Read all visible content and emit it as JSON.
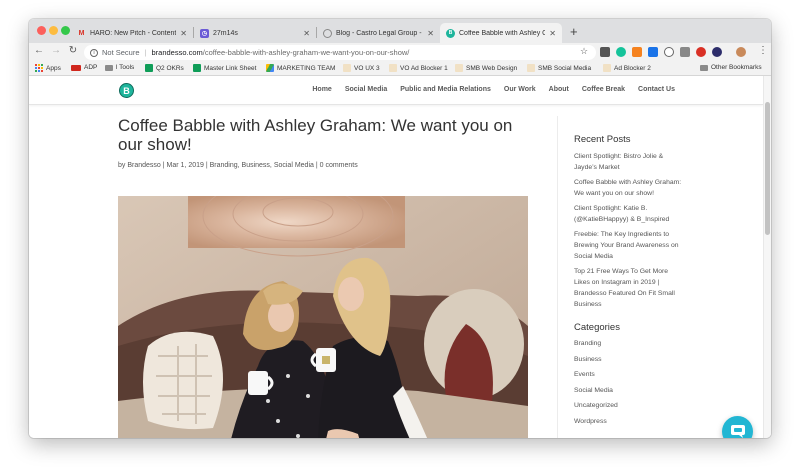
{
  "browser": {
    "tabs": [
      {
        "title": "HARO: New Pitch - Content M",
        "favicon": "gmail-icon",
        "active": false
      },
      {
        "title": "27m14s",
        "favicon": "timer-icon",
        "active": false
      },
      {
        "title": "Blog - Castro Legal Group - Ca",
        "favicon": "globe-icon",
        "active": false
      },
      {
        "title": "Coffee Babble with Ashley Gra",
        "favicon": "brandesso-icon",
        "active": true
      }
    ],
    "url": {
      "security_label": "Not Secure",
      "domain": "brandesso.com",
      "path": "/coffee-babble-with-ashley-graham-we-want-you-on-our-show/"
    },
    "bookmarks": [
      {
        "label": "Apps"
      },
      {
        "label": "ADP"
      },
      {
        "label": "l Tools"
      },
      {
        "label": "Q2 OKRs"
      },
      {
        "label": "Master Link Sheet"
      },
      {
        "label": "MARKETING TEAM"
      },
      {
        "label": "VO UX 3"
      },
      {
        "label": "VO Ad Blocker 1"
      },
      {
        "label": "SMB Web Design"
      },
      {
        "label": "SMB Social Media"
      },
      {
        "label": "Ad Blocker 2"
      },
      {
        "label": "Other Bookmarks"
      }
    ]
  },
  "site": {
    "logo_letter": "B",
    "nav": [
      "Home",
      "Social Media",
      "Public and Media Relations",
      "Our Work",
      "About",
      "Coffee Break",
      "Contact Us"
    ],
    "accent_color": "#1eb59c"
  },
  "post": {
    "title": "Coffee Babble with Ashley Graham: We want you on our show!",
    "meta": {
      "by": "by ",
      "author": "Brandesso",
      "sep1": " | ",
      "date": "Mar 1, 2019",
      "sep2": " | ",
      "categories": "Branding, Business, Social Media",
      "sep3": " | ",
      "comments": "0 comments"
    }
  },
  "sidebar": {
    "recent_heading": "Recent Posts",
    "recent_posts": [
      "Client Spotlight: Bistro Jolie & Jayde’s Market",
      "Coffee Babble with Ashley Graham: We want you on our show!",
      "Client Spotlight: Katie B. (@KatieBHappyy) & B_Inspired",
      "Freebie: The Key Ingredients to Brewing Your Brand Awareness on Social Media",
      "Top 21 Free Ways To Get More Likes on Instagram in 2019 | Brandesso Featured On Fit Small Business"
    ],
    "categories_heading": "Categories",
    "categories": [
      "Branding",
      "Business",
      "Events",
      "Social Media",
      "Uncategorized",
      "Wordpress"
    ]
  },
  "chat_widget": {
    "icon": "chat-bubble-icon",
    "color": "#22b6d3"
  }
}
